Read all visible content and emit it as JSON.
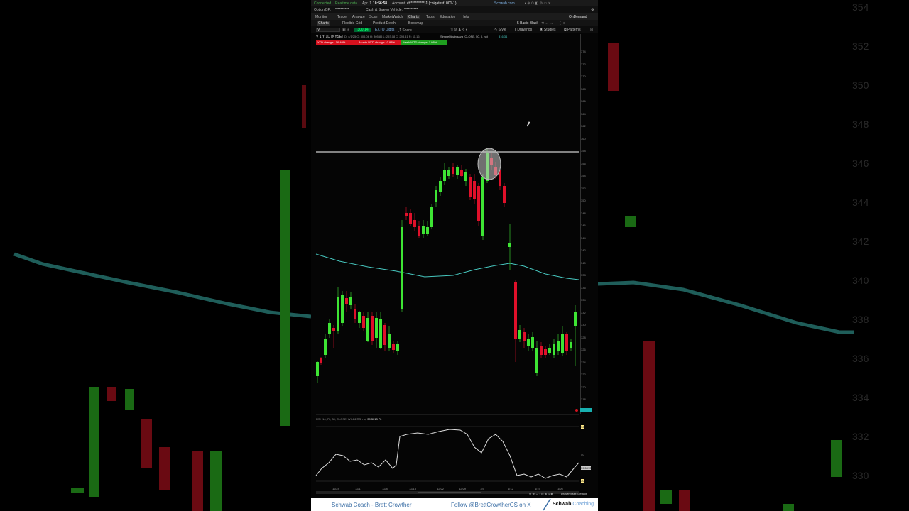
{
  "status_bar": {
    "connected": "Connected",
    "realtime": "Realtime data",
    "date": "Apr. 1",
    "time": "10:56:58",
    "account_label": "Account:",
    "account_value": "ch**********-1 (chiqatest1001-1)",
    "schwab": "Schwab.com"
  },
  "option_bp": {
    "label": "Option BP:",
    "value": "**********",
    "cash_label": "Cash & Sweep Vehicle:",
    "cash_value": "**********"
  },
  "menu": {
    "items": [
      "Monitor",
      "Trade",
      "Analyze",
      "Scan",
      "MarketWatch",
      "Charts",
      "Tools",
      "Education",
      "Help"
    ],
    "active": "Charts",
    "ondemand": "OnDemand"
  },
  "subtabs": {
    "items": [
      "Charts",
      "Flexible Grid",
      "Product Depth",
      "Bookmap"
    ],
    "layout": "5 Basic Black"
  },
  "toolbar": {
    "symbol": "V",
    "price": "300.14",
    "ext_label": "EXTO Digits",
    "share": "Share",
    "style": "Style",
    "drawings": "Drawings",
    "studies": "Studies",
    "patterns": "Patterns"
  },
  "info_line": {
    "symbol": "V 1 Y 1D [NYSE]",
    "ohlc": "D: 4/1/25  O: 305.06  H: 305.85  L: 293.08  C: 298.41  R: 11.16",
    "study": "SimpleMovingAvg (CLOSE, 50, 0, no)",
    "study_value": "316.34"
  },
  "pills": {
    "ytd": "YTD change: -16.40%",
    "mtd": "Month MTD change: -0.98%",
    "wtd": "Week WTD change: 1.98%"
  },
  "price_axis": [
    "374",
    "372",
    "370",
    "368",
    "366",
    "364",
    "362",
    "360",
    "358",
    "356",
    "354",
    "352",
    "350",
    "348",
    "346",
    "344",
    "342",
    "340",
    "338",
    "336",
    "334",
    "332",
    "330",
    "328",
    "326",
    "324",
    "322",
    "320",
    "318"
  ],
  "rsi": {
    "header": "RSI (14, 70, 30, CLOSE, WILDERS, no)",
    "value": "39.5013",
    "ob": "70",
    "levels": [
      "70",
      "50",
      "30"
    ]
  },
  "dates": [
    "11/24",
    "12/1",
    "12/8",
    "12/15",
    "12/22",
    "12/29",
    "1/5",
    "1/12",
    "1/19",
    "1/26"
  ],
  "drawing_set": "Drawing set: Default",
  "bottom": {
    "coach": "Schwab Coach - Brett Crowther",
    "follow": "Follow @BrettCrowtherCS on X",
    "brand_bold": "Schwab",
    "brand_light": "Coaching"
  },
  "colors": {
    "up": "#3ee534",
    "down": "#e0102a",
    "ma": "#47c8c0",
    "resistance": "#ffffff"
  },
  "bg_axis": [
    "354",
    "352",
    "350",
    "348",
    "346",
    "344",
    "342",
    "340",
    "338",
    "336",
    "334",
    "332",
    "330"
  ]
}
